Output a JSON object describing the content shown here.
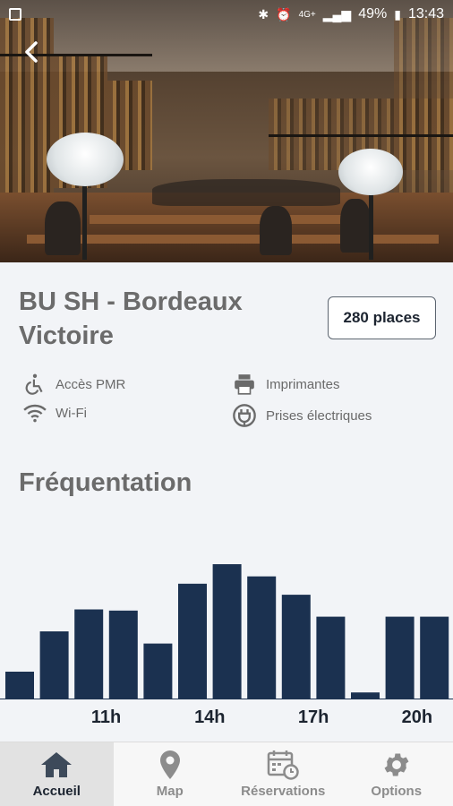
{
  "status": {
    "battery": "49%",
    "time": "13:43",
    "signal_label": "4G+"
  },
  "library": {
    "name": "BU SH - Bordeaux Victoire",
    "places": "280 places"
  },
  "features": [
    {
      "icon": "wheelchair-icon",
      "label": "Accès PMR"
    },
    {
      "icon": "printer-icon",
      "label": "Imprimantes"
    },
    {
      "icon": "wifi-icon",
      "label": "Wi-Fi"
    },
    {
      "icon": "plug-icon",
      "label": "Prises électriques"
    }
  ],
  "frequentation": {
    "title": "Fréquentation"
  },
  "chart_data": {
    "type": "bar",
    "hours": [
      9,
      10,
      11,
      12,
      13,
      14,
      15,
      16,
      17,
      18,
      19,
      20,
      21
    ],
    "values": [
      22,
      55,
      73,
      72,
      45,
      94,
      110,
      100,
      85,
      67,
      5,
      67,
      67
    ],
    "tick_labels": [
      "11h",
      "14h",
      "17h",
      "20h"
    ],
    "tick_hours": [
      11,
      14,
      17,
      20
    ],
    "bar_color": "#1b3150"
  },
  "nav": [
    {
      "icon": "home-icon",
      "label": "Accueil",
      "active": true
    },
    {
      "icon": "map-pin-icon",
      "label": "Map",
      "active": false
    },
    {
      "icon": "calendar-clock-icon",
      "label": "Réservations",
      "active": false
    },
    {
      "icon": "gear-icon",
      "label": "Options",
      "active": false
    }
  ]
}
